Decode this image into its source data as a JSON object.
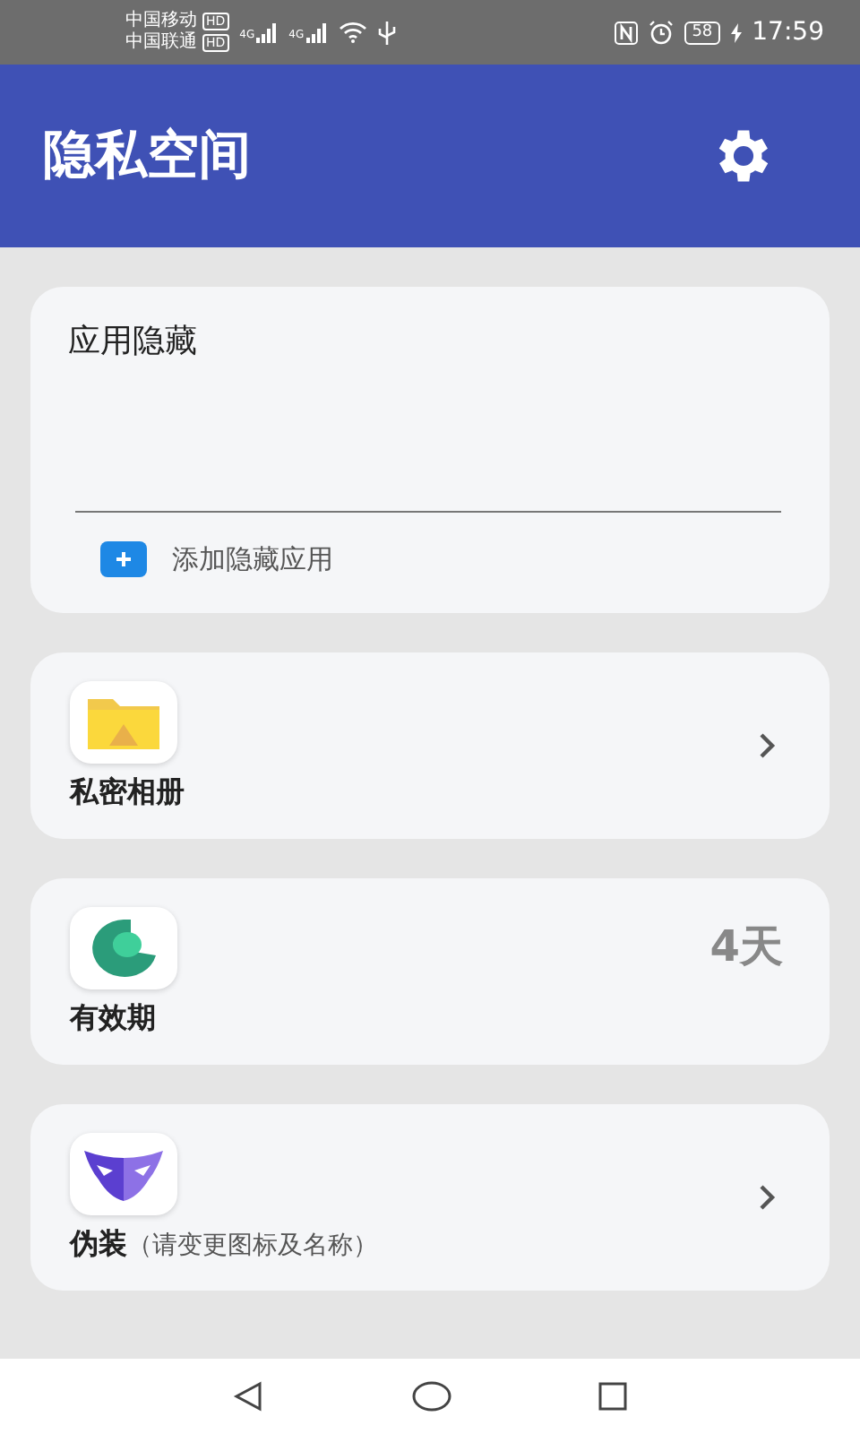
{
  "status_bar": {
    "carriers": [
      {
        "name": "中国移动",
        "badge": "HD"
      },
      {
        "name": "中国联通",
        "badge": "HD"
      }
    ],
    "networks": [
      "4G",
      "4G"
    ],
    "battery": "58",
    "time": "17:59"
  },
  "header": {
    "title": "隐私空间"
  },
  "hidden_apps": {
    "title": "应用隐藏",
    "add_label": "添加隐藏应用"
  },
  "items": [
    {
      "kind": "chevron",
      "label": "私密相册"
    },
    {
      "kind": "value",
      "label": "有效期",
      "value": "4天"
    },
    {
      "kind": "chevron",
      "label": "伪装",
      "note": "（请变更图标及名称）"
    }
  ]
}
